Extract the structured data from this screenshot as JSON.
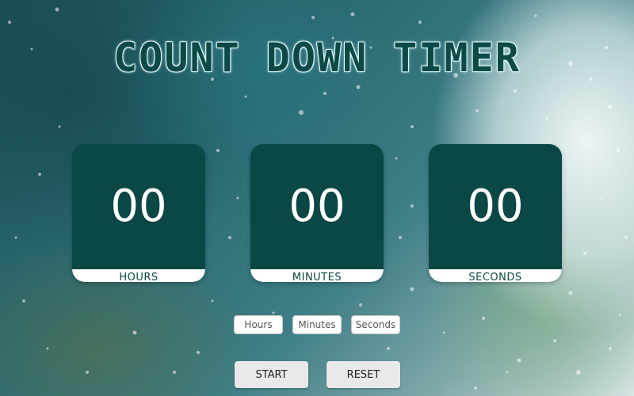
{
  "title": "COUNT DOWN TIMER",
  "timer": {
    "hours": {
      "value": "00",
      "label": "HOURS"
    },
    "minutes": {
      "value": "00",
      "label": "MINUTES"
    },
    "seconds": {
      "value": "00",
      "label": "SECONDS"
    }
  },
  "inputs": {
    "hours_placeholder": "Hours",
    "minutes_placeholder": "Minutes",
    "seconds_placeholder": "Seconds"
  },
  "buttons": {
    "start_label": "START",
    "reset_label": "RESET"
  },
  "colors": {
    "card": "#0b4744",
    "title": "#0d4a47",
    "button": "#e9e9e9"
  }
}
